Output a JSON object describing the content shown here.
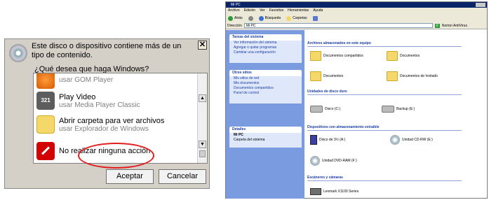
{
  "dialog": {
    "message": "Este disco o dispositivo contiene más de un tipo de contenido.",
    "question": "¿Qué desea que haga Windows?",
    "options": [
      {
        "title": "",
        "subtitle": "usar GOM Player"
      },
      {
        "title": "Play Video",
        "subtitle": "usar Media Player Classic"
      },
      {
        "title": "Abrir carpeta para ver archivos",
        "subtitle": "usar Explorador de Windows"
      },
      {
        "title": "No realizar ninguna acción",
        "subtitle": ""
      }
    ],
    "mpc_icon_text": "321",
    "close_glyph": "✕",
    "accept": "Aceptar",
    "cancel": "Cancelar"
  },
  "explorer": {
    "title": "Mi PC",
    "menu": [
      "Archivo",
      "Edición",
      "Ver",
      "Favoritos",
      "Herramientas",
      "Ayuda"
    ],
    "toolbar": {
      "back": "Atrás",
      "search": "Búsqueda",
      "folders": "Carpetas"
    },
    "address_label": "Dirección",
    "address_value": "Mi PC",
    "go": "Ir",
    "links": "Norton AntiVirus",
    "tasks": {
      "header": "Tareas del sistema",
      "items": [
        "Ver información del sistema",
        "Agregar o quitar programas",
        "Cambiar una configuración"
      ]
    },
    "places": {
      "header": "Otros sitios",
      "items": [
        "Mis sitios de red",
        "Mis documentos",
        "Documentos compartidos",
        "Panel de control"
      ]
    },
    "details": {
      "header": "Detalles",
      "name": "Mi PC",
      "type": "Carpeta del sistema"
    },
    "sections": {
      "stored": "Archivos almacenados en este equipo",
      "hdd": "Unidades de disco duro",
      "removable": "Dispositivos con almacenamiento extraíble",
      "scanners": "Escáneres y cámaras"
    },
    "stored_items": [
      "Documentos compartidos",
      "Documentos",
      "Documentos",
      "Documentos de Invitado"
    ],
    "hdd_items": [
      "Disco (C:)",
      "Backup (E:)"
    ],
    "removable_items": [
      "Disco de 3½ (A:)",
      "Unidad CD-RW (E:)",
      "Unidad DVD-RAM (F:)"
    ],
    "scanner_items": [
      "Lexmark X1100 Series"
    ],
    "colors": {
      "highlight": "#e21d1d",
      "title_bar": "#0a246a",
      "side_panel": "#7b9be0"
    }
  }
}
